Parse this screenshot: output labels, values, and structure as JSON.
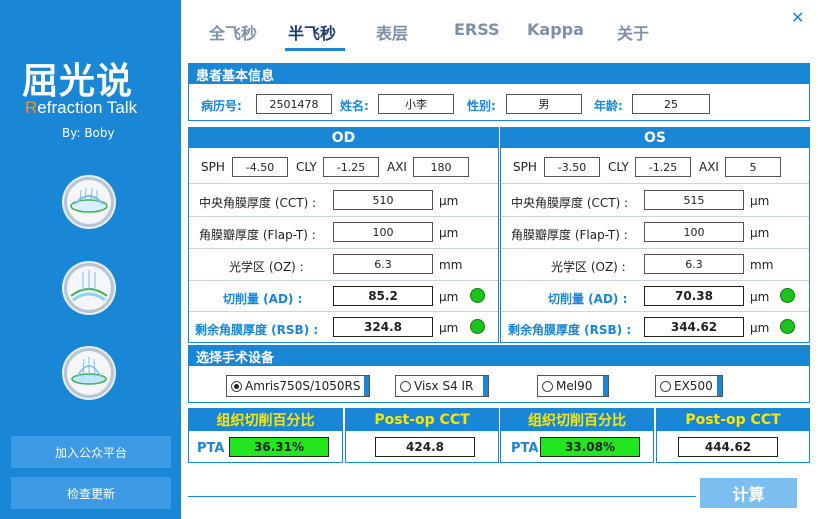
{
  "brand": {
    "cn": "屈光说",
    "en_r": "R",
    "en_rest": "efraction Talk",
    "byline": "By: Boby"
  },
  "sidebar": {
    "btn_join": "加入公众平台",
    "btn_update": "检查更新"
  },
  "tabs": [
    "全飞秒",
    "半飞秒",
    "表层",
    "ERSS",
    "Kappa",
    "关于"
  ],
  "active_tab": "半飞秒",
  "close": "✕",
  "patient": {
    "header": "患者基本信息",
    "id_label": "病历号:",
    "id": "2501478",
    "name_label": "姓名:",
    "name": "小李",
    "gender_label": "性别:",
    "gender": "男",
    "age_label": "年龄:",
    "age": "25"
  },
  "labels": {
    "sph": "SPH",
    "cly": "CLY",
    "axi": "AXI",
    "cct": "中央角膜厚度 (CCT) :",
    "flap": "角膜瓣厚度 (Flap-T) :",
    "oz": "光学区 (OZ) :",
    "ad": "切削量 (AD) :",
    "rsb": "剩余角膜厚度 (RSB) :",
    "um": "μm",
    "mm": "mm"
  },
  "od": {
    "title": "OD",
    "sph": "-4.50",
    "cly": "-1.25",
    "axi": "180",
    "cct": "510",
    "flap": "100",
    "oz": "6.3",
    "ad": "85.2",
    "rsb": "324.8"
  },
  "os": {
    "title": "OS",
    "sph": "-3.50",
    "cly": "-1.25",
    "axi": "5",
    "cct": "515",
    "flap": "100",
    "oz": "6.3",
    "ad": "70.38",
    "rsb": "344.62"
  },
  "status_color": "#1dc31d",
  "device": {
    "header": "选择手术设备",
    "options": [
      "Amris750S/1050RS",
      "Visx S4 IR",
      "Mel90",
      "EX500"
    ],
    "selected": "Amris750S/1050RS"
  },
  "results": {
    "pta_title": "组织切削百分比",
    "postop_title": "Post-op CCT",
    "pta_label": "PTA",
    "od_pta": "36.31%",
    "od_postop": "424.8",
    "os_pta": "33.08%",
    "os_postop": "444.62"
  },
  "calc_button": "计算"
}
